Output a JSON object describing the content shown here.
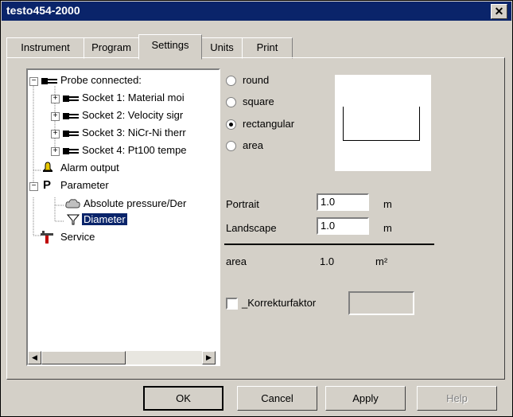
{
  "window": {
    "title": "testo454-2000",
    "close_glyph": "✕"
  },
  "tabs": [
    {
      "label": "Instrument"
    },
    {
      "label": "Program"
    },
    {
      "label": "Settings",
      "active": true
    },
    {
      "label": "Units"
    },
    {
      "label": "Print"
    }
  ],
  "tree": {
    "probe_connected": "Probe connected:",
    "sockets": [
      "Socket 1: Material moi",
      "Socket 2: Velocity sigr",
      "Socket 3: NiCr-Ni therr",
      "Socket 4: Pt100 tempe"
    ],
    "alarm_output": "Alarm output",
    "parameter_icon": "P",
    "parameter": "Parameter",
    "absolute_pressure": "Absolute pressure/Der",
    "diameter": "Diameter",
    "service": "Service"
  },
  "shape_options": [
    {
      "label": "round",
      "checked": false
    },
    {
      "label": "square",
      "checked": false
    },
    {
      "label": "rectangular",
      "checked": true
    },
    {
      "label": "area",
      "checked": false
    }
  ],
  "dimensions": {
    "portrait_label": "Portrait",
    "portrait_value": "1.0",
    "portrait_unit": "m",
    "landscape_label": "Landscape",
    "landscape_value": "1.0",
    "landscape_unit": "m",
    "area_label": "area",
    "area_value": "1.0",
    "area_unit": "m²"
  },
  "correction": {
    "label": "_Korrekturfaktor",
    "checked": false,
    "value": ""
  },
  "buttons": {
    "ok": "OK",
    "cancel": "Cancel",
    "apply": "Apply",
    "help": "Help"
  },
  "colors": {
    "titlebar": "#0a246a",
    "face": "#d4d0c8",
    "selection": "#0a246a"
  }
}
